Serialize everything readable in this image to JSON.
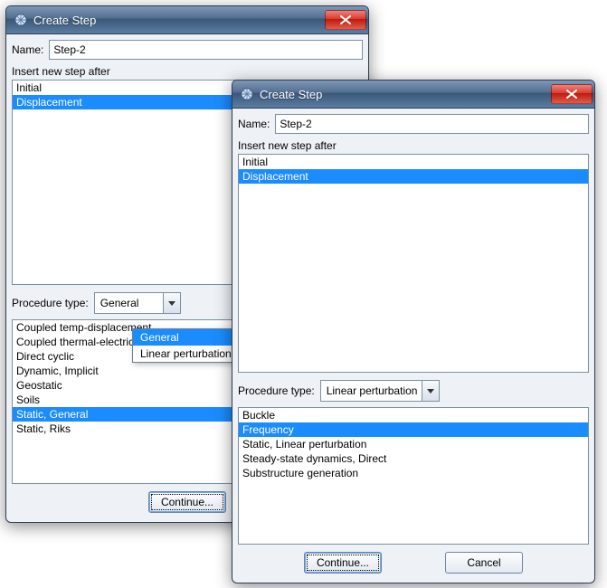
{
  "colors": {
    "sel": "#1a8cff",
    "close": "#d93a2b"
  },
  "win1": {
    "title": "Create Step",
    "name_label": "Name:",
    "name_value": "Step-2",
    "insert_label": "Insert new step after",
    "insert_items": [
      "Initial",
      "Displacement"
    ],
    "insert_selected": "Displacement",
    "proc_label": "Procedure type:",
    "proc_value": "General",
    "proc_options": [
      "General",
      "Linear perturbation"
    ],
    "list_items": [
      "Coupled temp-displacement",
      "Coupled thermal-electrical",
      "Direct cyclic",
      "Dynamic, Implicit",
      "Geostatic",
      "Soils",
      "Static, General",
      "Static, Riks"
    ],
    "list_selected": "Static, General",
    "continue_label": "Continue..."
  },
  "win2": {
    "title": "Create Step",
    "name_label": "Name:",
    "name_value": "Step-2",
    "insert_label": "Insert new step after",
    "insert_items": [
      "Initial",
      "Displacement"
    ],
    "insert_selected": "Displacement",
    "proc_label": "Procedure type:",
    "proc_value": "Linear perturbation",
    "list_items": [
      "Buckle",
      "Frequency",
      "Static, Linear perturbation",
      "Steady-state dynamics, Direct",
      "Substructure generation"
    ],
    "list_selected": "Frequency",
    "continue_label": "Continue...",
    "cancel_label": "Cancel"
  }
}
